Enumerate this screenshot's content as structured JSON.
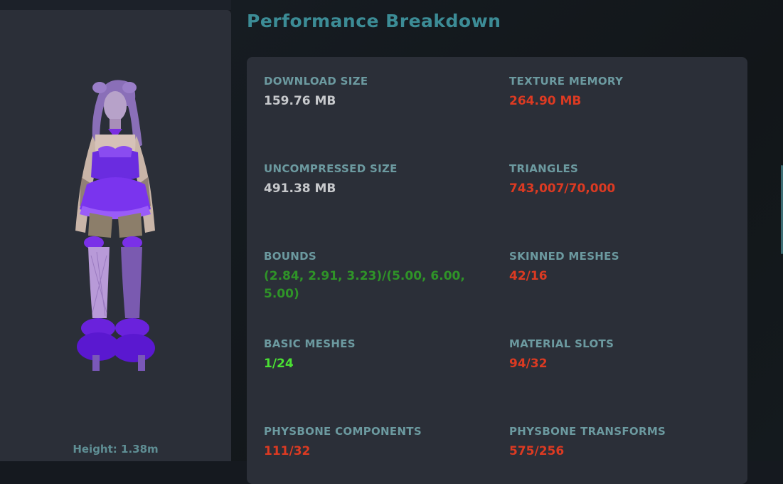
{
  "preview": {
    "height_label": "Height: 1.38m"
  },
  "title": "Performance Breakdown",
  "stats": [
    {
      "label": "DOWNLOAD SIZE",
      "value": "159.76 MB",
      "color": "#c7c9cc"
    },
    {
      "label": "TEXTURE MEMORY",
      "value": "264.90 MB",
      "color": "#dc3a22"
    },
    {
      "label": "UNCOMPRESSED SIZE",
      "value": "491.38 MB",
      "color": "#c7c9cc"
    },
    {
      "label": "TRIANGLES",
      "value": "743,007/70,000",
      "color": "#dc3a22"
    },
    {
      "label": "BOUNDS",
      "value": "(2.84, 2.91, 3.23)/(5.00, 6.00, 5.00)",
      "color": "#2f9428"
    },
    {
      "label": "SKINNED MESHES",
      "value": "42/16",
      "color": "#dc3a22"
    },
    {
      "label": "BASIC MESHES",
      "value": "1/24",
      "color": "#4ae033"
    },
    {
      "label": "MATERIAL SLOTS",
      "value": "94/32",
      "color": "#dc3a22"
    },
    {
      "label": "PHYSBONE COMPONENTS",
      "value": "111/32",
      "color": "#dc3a22"
    },
    {
      "label": "PHYSBONE TRANSFORMS",
      "value": "575/256",
      "color": "#dc3a22"
    }
  ]
}
